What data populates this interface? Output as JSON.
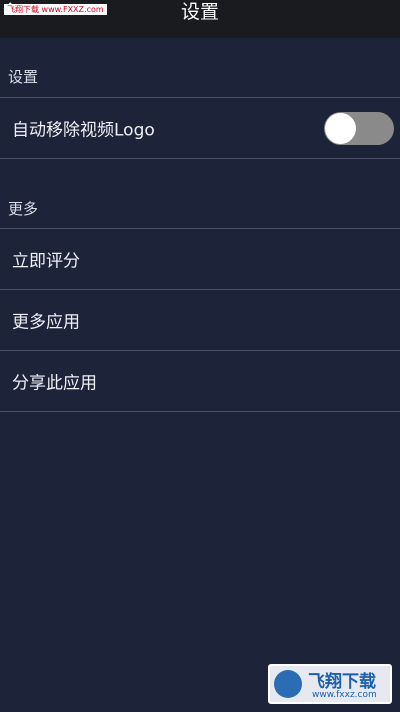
{
  "header": {
    "title": "设置",
    "back_icon": "back-arrow-icon",
    "watermark": "飞翔下载 www.FXXZ.com"
  },
  "sections": [
    {
      "title": "设置",
      "items": [
        {
          "label": "自动移除视频Logo",
          "toggle": {
            "on": false
          }
        }
      ]
    },
    {
      "title": "更多",
      "items": [
        {
          "label": "立即评分"
        },
        {
          "label": "更多应用"
        },
        {
          "label": "分享此应用"
        }
      ]
    }
  ],
  "watermark_bottom": {
    "brand": "飞翔下载",
    "domain": "www.fxxz.com"
  },
  "colors": {
    "background": "#1d2339",
    "titlebar": "#1a1b1f",
    "divider": "#4a5068",
    "toggle_off": "#8a8a8a"
  }
}
